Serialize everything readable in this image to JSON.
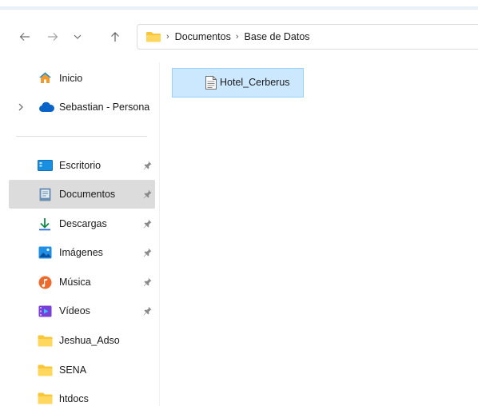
{
  "breadcrumb": [
    "Documentos",
    "Base de Datos"
  ],
  "sidebar": {
    "top": [
      {
        "label": "Inicio",
        "icon": "home-icon"
      },
      {
        "label": "Sebastian - Persona",
        "icon": "onedrive-cloud-icon"
      }
    ],
    "quick_access": [
      {
        "label": "Escritorio",
        "icon": "desktop-icon",
        "pinned": true
      },
      {
        "label": "Documentos",
        "icon": "documents-icon",
        "pinned": true,
        "selected": true
      },
      {
        "label": "Descargas",
        "icon": "downloads-icon",
        "pinned": true
      },
      {
        "label": "Imágenes",
        "icon": "pictures-icon",
        "pinned": true
      },
      {
        "label": "Música",
        "icon": "music-icon",
        "pinned": true
      },
      {
        "label": "Vídeos",
        "icon": "videos-icon",
        "pinned": true
      },
      {
        "label": "Jeshua_Adso",
        "icon": "folder-icon",
        "pinned": false
      },
      {
        "label": "SENA",
        "icon": "folder-icon",
        "pinned": false
      },
      {
        "label": "htdocs",
        "icon": "folder-icon",
        "pinned": false
      }
    ]
  },
  "content": {
    "items": [
      {
        "label": "Hotel_Cerberus",
        "icon": "text-document-icon",
        "selected": true
      }
    ]
  },
  "colors": {
    "selection_fill": "#cce8ff",
    "selection_border": "#99d1ff",
    "sidebar_selected": "#dcdcdc",
    "folder_yellow": "#f8c636"
  }
}
